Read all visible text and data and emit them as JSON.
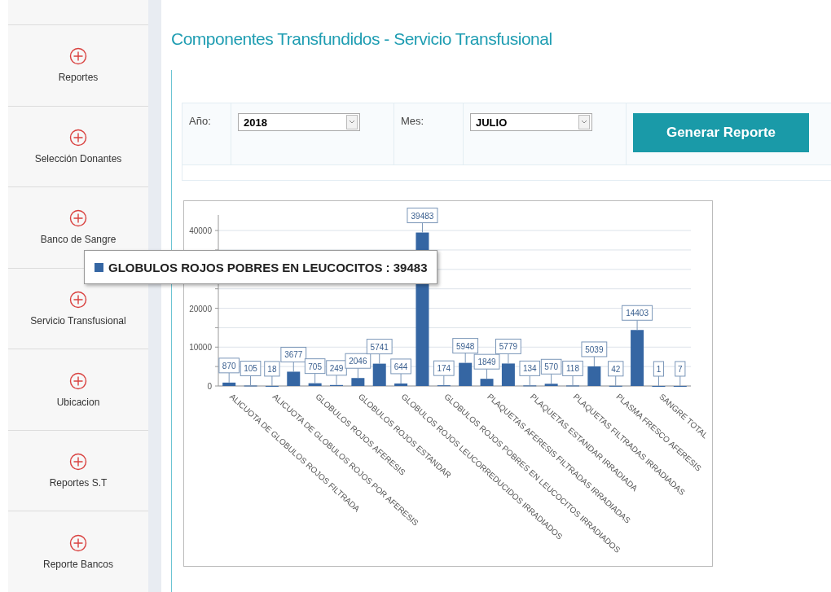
{
  "sidebar": {
    "items": [
      {
        "label": "Reportes"
      },
      {
        "label": "Selección Donantes"
      },
      {
        "label": "Banco de Sangre"
      },
      {
        "label": "Servicio Transfusional"
      },
      {
        "label": "Ubicacion"
      },
      {
        "label": "Reportes S.T"
      },
      {
        "label": "Reporte Bancos"
      }
    ]
  },
  "page": {
    "title": "Componentes Transfundidos - Servicio Transfusional"
  },
  "filters": {
    "year_label": "Año:",
    "year_value": "2018",
    "month_label": "Mes:",
    "month_value": "JULIO",
    "generate_button": "Generar Reporte"
  },
  "chart": {
    "tooltip": "GLOBULOS ROJOS POBRES EN LEUCOCITOS : 39483",
    "chart_data": {
      "type": "bar",
      "categories": [
        "ALICUOTA DE GLOBULOS ROJOS FILTRADA",
        null,
        "ALICUOTA DE GLOBULOS ROJOS POR AFERESIS",
        null,
        "GLOBULOS ROJOS AFERESIS",
        null,
        "GLOBULOS ROJOS ESTANDAR",
        null,
        "GLOBULOS ROJOS LEUCORREDUCIDOS IRRADIADOS",
        null,
        "GLOBULOS ROJOS POBRES EN LEUCOCITOS IRRADIADOS",
        null,
        "PLAQUETAS AFERESIS FILTRADAS IRRADIADAS",
        null,
        "PLAQUETAS ESTANDAR IRRADIADA",
        null,
        "PLAQUETAS FILTRADAS IRRADIADAS",
        null,
        "PLASMA FRESCO AFERESIS",
        null,
        "SANGRE TOTAL",
        null
      ],
      "series": [
        {
          "color": "#3566a3",
          "values": [
            870,
            105,
            18,
            3677,
            705,
            249,
            2046,
            5741,
            644,
            39483,
            174,
            5948,
            1849,
            5779,
            134,
            570,
            118,
            5039,
            42,
            14403,
            1,
            7
          ]
        }
      ],
      "ylim": [
        0,
        44000
      ],
      "yticks": [
        0,
        10000,
        20000,
        40000
      ],
      "data_labels": true,
      "grid": true
    }
  }
}
